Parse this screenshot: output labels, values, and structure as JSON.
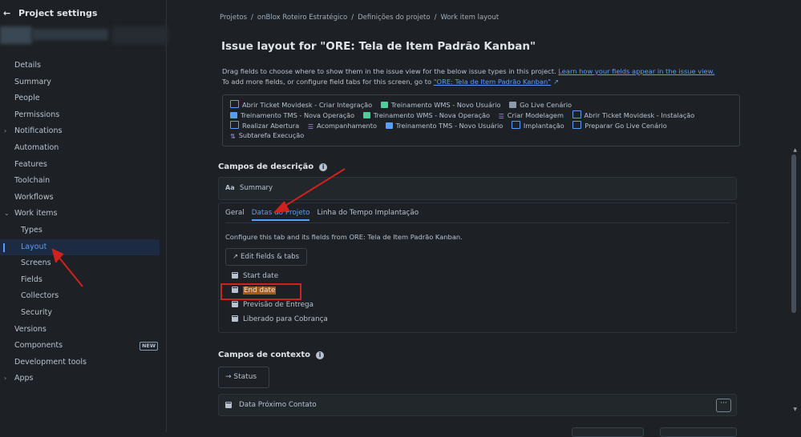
{
  "sidebar": {
    "back_arrow": "←",
    "title": "Project settings",
    "items": [
      {
        "label": "Details",
        "caret": ""
      },
      {
        "label": "Summary",
        "caret": ""
      },
      {
        "label": "People",
        "caret": ""
      },
      {
        "label": "Permissions",
        "caret": ""
      },
      {
        "label": "Notifications",
        "caret": "›"
      },
      {
        "label": "Automation",
        "caret": ""
      },
      {
        "label": "Features",
        "caret": ""
      },
      {
        "label": "Toolchain",
        "caret": ""
      },
      {
        "label": "Workflows",
        "caret": ""
      },
      {
        "label": "Work items",
        "caret": "⌄"
      },
      {
        "label": "Types",
        "caret": ""
      },
      {
        "label": "Layout",
        "caret": ""
      },
      {
        "label": "Screens",
        "caret": ""
      },
      {
        "label": "Fields",
        "caret": ""
      },
      {
        "label": "Collectors",
        "caret": ""
      },
      {
        "label": "Security",
        "caret": ""
      },
      {
        "label": "Versions",
        "caret": ""
      },
      {
        "label": "Components",
        "caret": ""
      },
      {
        "label": "Development tools",
        "caret": ""
      },
      {
        "label": "Apps",
        "caret": "›"
      }
    ],
    "new_badge": "NEW"
  },
  "breadcrumb": [
    "Projetos",
    "onBlox Roteiro Estratégico",
    "Definições do projeto",
    "Work item layout"
  ],
  "breadcrumb_sep": "/",
  "page_title": "Issue layout for \"ORE: Tela de Item Padrão Kanban\"",
  "description": {
    "line1": "Drag fields to choose where to show them in the issue view for the below issue types in this project.",
    "line1_link": "Learn how your fields appear in the issue view.",
    "line2": "To add more fields, or configure field tabs for this screen, go to",
    "line2_link": "\"ORE: Tela de Item Padrão Kanban\"",
    "ext_icon": "↗"
  },
  "issue_types": {
    "row1": [
      "Abrir Ticket Movidesk - Criar Integração",
      "Treinamento WMS - Novo Usuário",
      "Go Live Cenário"
    ],
    "row2": [
      "Treinamento TMS - Nova Operação",
      "Treinamento WMS - Nova Operação",
      "Criar Modelagem",
      "Abrir Ticket Movidesk - Instalação"
    ],
    "row3": [
      "Realizar Abertura",
      "Acompanhamento",
      "Treinamento TMS - Novo Usuário",
      "Implantação",
      "Preparar Go Live Cenário"
    ],
    "row4": [
      "Subtarefa Execução"
    ]
  },
  "description_fields": {
    "title": "Campos de descrição",
    "info_icon": "i",
    "summary_icon": "Aa",
    "summary_label": "Summary",
    "tabs": [
      "Geral",
      "Datas do Projeto",
      "Linha do Tempo Implantação"
    ],
    "config_text": "Configure this tab and its fields from ORE: Tela de Item Padrão Kanban.",
    "edit_button": "Edit fields & tabs",
    "edit_icon": "↗",
    "fields": [
      "Start date",
      "End date",
      "Previsão de Entrega",
      "Liberado para Cobrança"
    ]
  },
  "context_fields": {
    "title": "Campos de contexto",
    "info_icon": "i",
    "status_icon": "→",
    "status_label": "Status",
    "contact_label": "Data Próximo Contato",
    "more_icon": "···"
  },
  "colors": {
    "background": "#1d2125",
    "accent": "#579dff",
    "annotation_red": "#d0221c"
  }
}
